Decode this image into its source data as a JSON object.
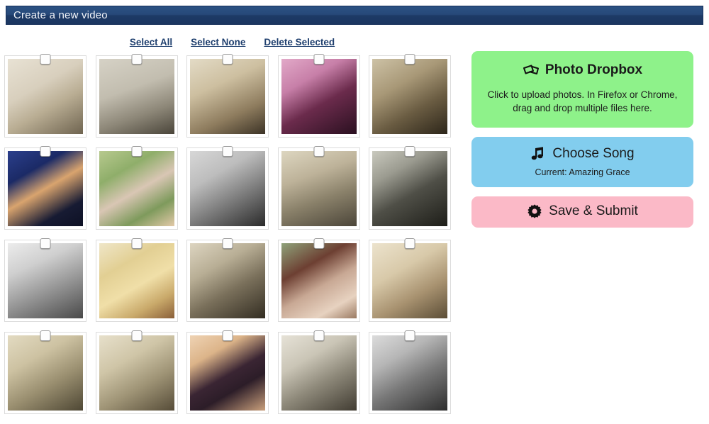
{
  "header": {
    "title": "Create a new video"
  },
  "toolbar": {
    "select_all": "Select All",
    "select_none": "Select None",
    "delete_selected": "Delete Selected"
  },
  "panel": {
    "dropbox": {
      "icon": "photos-icon",
      "title": "Photo Dropbox",
      "description": "Click to upload photos. In Firefox or Chrome, drag and drop multiple files here.",
      "color": "#8ef28a"
    },
    "song": {
      "icon": "music-note-icon",
      "title": "Choose Song",
      "current": "Current: Amazing Grace",
      "color": "#82cdee"
    },
    "save": {
      "icon": "gear-icon",
      "title": "Save & Submit",
      "color": "#fbb9c7"
    }
  },
  "grid": {
    "columns": 5,
    "rows": 4,
    "checkbox_checked": false,
    "photos": [
      {
        "id": "photo-1",
        "description": "Sepia baby girl in high chair",
        "tone": "sepia-light",
        "checked": false
      },
      {
        "id": "photo-2",
        "description": "Sepia toddler girl sitting on bench",
        "tone": "sepia-grey",
        "checked": false
      },
      {
        "id": "photo-3",
        "description": "Sepia portrait of smiling young woman",
        "tone": "sepia-warm",
        "checked": false
      },
      {
        "id": "photo-4",
        "description": "Color studio portrait of woman, pink backdrop",
        "tone": "pink-studio",
        "checked": false
      },
      {
        "id": "photo-5",
        "description": "Sepia man reading book with two girls",
        "tone": "sepia-dark",
        "checked": false
      },
      {
        "id": "photo-6",
        "description": "Color school portrait of young girl on blue backdrop",
        "tone": "blue-studio",
        "checked": false
      },
      {
        "id": "photo-7",
        "description": "Color photo of elderly couple in flower garden",
        "tone": "garden",
        "checked": false
      },
      {
        "id": "photo-8",
        "description": "Black and white photo of couple",
        "tone": "bw-couple",
        "checked": false
      },
      {
        "id": "photo-9",
        "description": "Sepia family group on porch steps with dog",
        "tone": "sepia-group",
        "checked": false
      },
      {
        "id": "photo-10",
        "description": "Black and white woman in dark dress outdoors",
        "tone": "bw-outdoor",
        "checked": false
      },
      {
        "id": "photo-11",
        "description": "Black and white group beside house",
        "tone": "bw-house",
        "checked": false
      },
      {
        "id": "photo-12",
        "description": "Color photo of man on couch holding dog",
        "tone": "couch",
        "checked": false
      },
      {
        "id": "photo-13",
        "description": "Sepia man in suit and hat beside car",
        "tone": "sepia-car",
        "checked": false
      },
      {
        "id": "photo-14",
        "description": "Color photo of couple in front of brick house",
        "tone": "brick-house",
        "checked": false
      },
      {
        "id": "photo-15",
        "description": "Sepia portrait of smiling blonde woman",
        "tone": "sepia-portrait",
        "checked": false
      },
      {
        "id": "photo-16",
        "description": "Sepia girl standing among trees",
        "tone": "sepia-trees",
        "checked": false
      },
      {
        "id": "photo-17",
        "description": "Sepia woman in long dress outdoors",
        "tone": "sepia-dress",
        "checked": false
      },
      {
        "id": "photo-18",
        "description": "Color polaroid of person in witch costume with handwriting",
        "tone": "polaroid",
        "checked": false
      },
      {
        "id": "photo-19",
        "description": "Black and white two women seated on car bumper",
        "tone": "bw-car",
        "checked": false
      },
      {
        "id": "photo-20",
        "description": "Black and white group of women at party table",
        "tone": "bw-party",
        "checked": false
      }
    ]
  }
}
